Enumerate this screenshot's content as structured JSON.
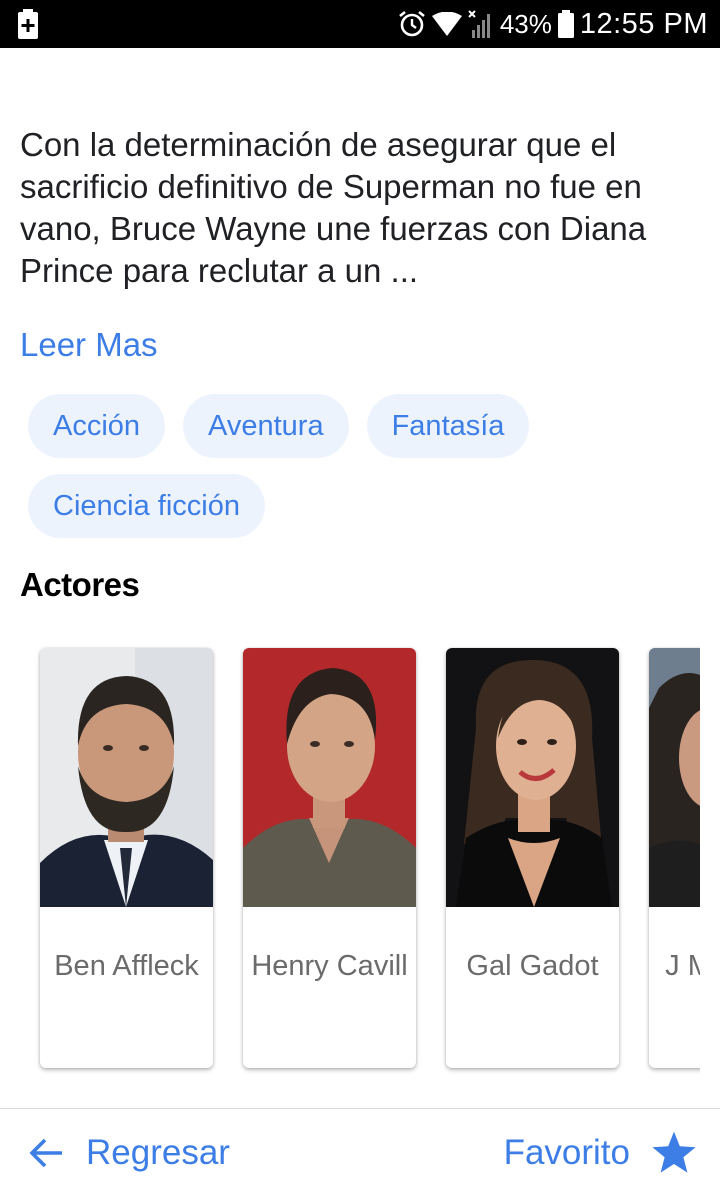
{
  "status_bar": {
    "battery_percent": "43%",
    "time": "12:55 PM",
    "icons": [
      "battery-saver-icon",
      "alarm-icon",
      "wifi-icon",
      "signal-icon",
      "battery-icon"
    ]
  },
  "movie": {
    "overview": "Con la determinación de asegurar que el sacrificio definitivo de Superman no fue en vano, Bruce Wayne une fuerzas con Diana Prince para reclutar a un ...",
    "read_more_label": "Leer Mas",
    "genres": [
      "Acción",
      "Aventura",
      "Fantasía",
      "Ciencia ficción"
    ]
  },
  "actors_section": {
    "title": "Actores",
    "actors": [
      {
        "name": "Ben Affleck"
      },
      {
        "name": "Henry Cavill"
      },
      {
        "name": "Gal Gadot"
      },
      {
        "name": "J M"
      }
    ]
  },
  "bottom_bar": {
    "back_label": "Regresar",
    "favorite_label": "Favorito"
  },
  "colors": {
    "accent": "#3c7ee5",
    "chip_bg": "#edf3fd",
    "text_primary": "#202124",
    "text_secondary": "#6b6b6b"
  }
}
